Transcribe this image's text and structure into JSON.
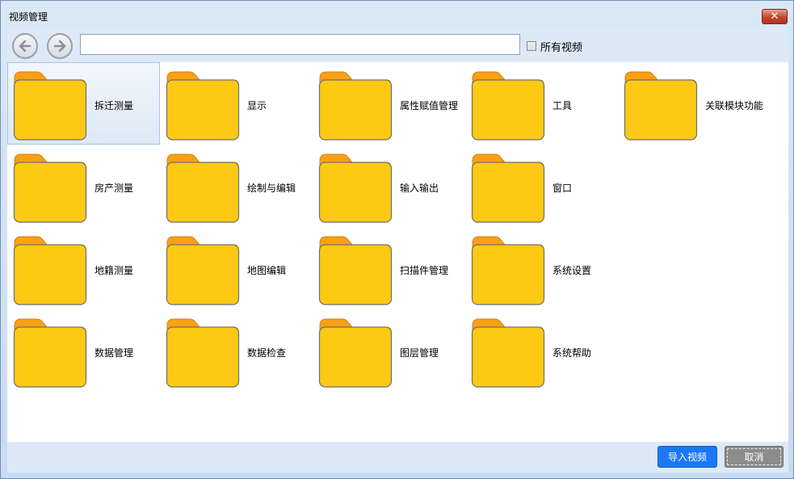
{
  "window": {
    "title": "视频管理",
    "close_symbol": "✕"
  },
  "toolbar": {
    "back_icon": "arrow-left-icon",
    "forward_icon": "arrow-right-icon",
    "path_value": "",
    "all_videos_label": "所有视频",
    "all_videos_checked": false
  },
  "folders": [
    {
      "label": "拆迁测量",
      "selected": true
    },
    {
      "label": "显示"
    },
    {
      "label": "属性赋值管理"
    },
    {
      "label": "工具"
    },
    {
      "label": "关联模块功能"
    },
    {
      "label": "房产测量"
    },
    {
      "label": "绘制与编辑"
    },
    {
      "label": "输入输出"
    },
    {
      "label": "窗口"
    },
    {
      "label": "地籍测量"
    },
    {
      "label": "地图编辑"
    },
    {
      "label": "扫描件管理"
    },
    {
      "label": "系统设置"
    },
    {
      "label": "数据管理"
    },
    {
      "label": "数据检查"
    },
    {
      "label": "图层管理"
    },
    {
      "label": "系统帮助"
    }
  ],
  "footer": {
    "import_label": "导入视频",
    "cancel_label": "取消"
  },
  "colors": {
    "folder_front": "#fec914",
    "folder_back": "#fca013",
    "primary_button": "#1b78f5",
    "cancel_button": "#8c8c8c",
    "close_button": "#c8432a"
  }
}
